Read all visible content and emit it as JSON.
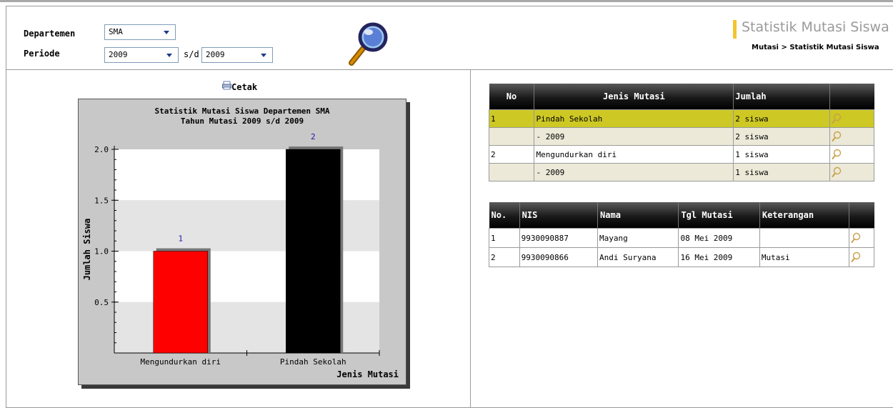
{
  "filters": {
    "departemen_label": "Departemen",
    "departemen_value": "SMA",
    "periode_label": "Periode",
    "periode_from": "2009",
    "periode_sep": "s/d",
    "periode_to": "2009"
  },
  "header": {
    "title": "Statistik Mutasi Siswa",
    "breadcrumb": "Mutasi >  Statistik Mutasi Siswa"
  },
  "cetak_label": "Cetak",
  "chart_data": {
    "type": "bar",
    "title_line1": "Statistik Mutasi Siswa Departemen SMA",
    "title_line2": "Tahun Mutasi 2009 s/d 2009",
    "categories": [
      "Mengundurkan diri",
      "Pindah Sekolah"
    ],
    "values": [
      1,
      2
    ],
    "bar_colors": [
      "#ff0000",
      "#000000"
    ],
    "xlabel": "Jenis Mutasi",
    "ylabel": "Jumlah Siswa",
    "ylim": [
      0,
      2.0
    ],
    "yticks": [
      "0.5",
      "1.0",
      "1.5",
      "2.0"
    ],
    "grid": true
  },
  "mutasi_table": {
    "headers": [
      "No",
      "Jenis Mutasi",
      "Jumlah",
      ""
    ],
    "rows": [
      {
        "no": "1",
        "jenis": "Pindah Sekolah",
        "jumlah": "2 siswa"
      },
      {
        "no": "",
        "jenis": "- 2009",
        "jumlah": "2 siswa"
      },
      {
        "no": "2",
        "jenis": "Mengundurkan diri",
        "jumlah": "1 siswa"
      },
      {
        "no": "",
        "jenis": "- 2009",
        "jumlah": "1 siswa"
      }
    ]
  },
  "siswa_table": {
    "headers": [
      "No.",
      "NIS",
      "Nama",
      "Tgl Mutasi",
      "Keterangan",
      ""
    ],
    "rows": [
      {
        "no": "1",
        "nis": "9930090887",
        "nama": "Mayang",
        "tgl": "08 Mei 2009",
        "ket": ""
      },
      {
        "no": "2",
        "nis": "9930090866",
        "nama": "Andi Suryana",
        "tgl": "16 Mei 2009",
        "ket": "Mutasi"
      }
    ]
  },
  "colors": {
    "highlight_row": "#cdc824",
    "alt_row": "#ece9d8",
    "title_accent": "#f4c430"
  }
}
